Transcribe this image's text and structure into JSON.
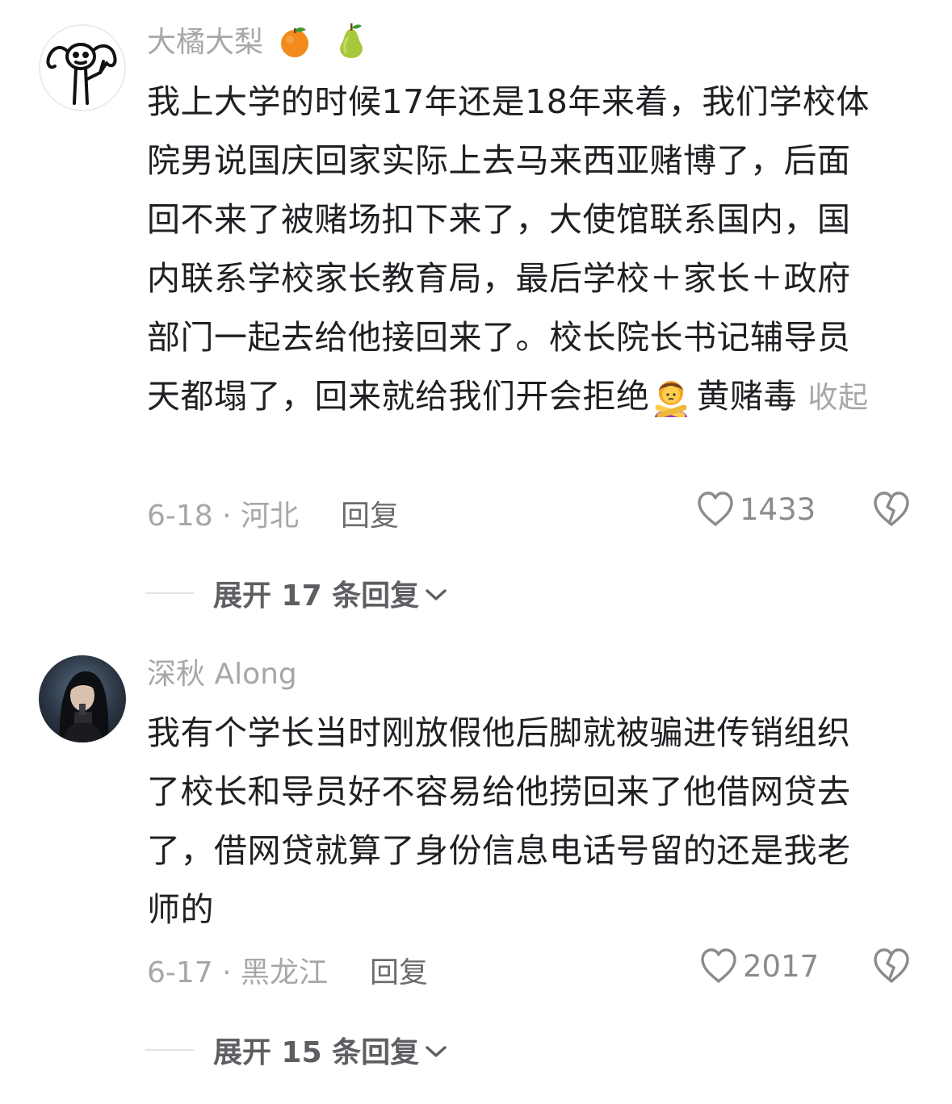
{
  "comments": [
    {
      "username": "大橘大梨",
      "username_emojis": [
        "orange-emoji",
        "pear-emoji"
      ],
      "content": "我上大学的时候17年还是18年来着，我们学校体院男说国庆回家实际上去马来西亚赌博了，后面回不来了被赌场扣下来了，大使馆联系国内，国内联系学校家长教育局，最后学校＋家长＋政府部门一起去给他接回来了。校长院长书记辅导员天都塌了，回来就给我们开会拒绝",
      "content_tail": "黄赌毒",
      "collapse_label": "收起",
      "date_location": "6-18 · 河北",
      "reply_label": "回复",
      "likes": "1433",
      "expand_label": "展开 17 条回复"
    },
    {
      "username": "深秋 Along",
      "content": "我有个学长当时刚放假他后脚就被骗进传销组织了校长和导员好不容易给他捞回来了他借网贷去了，借网贷就算了身份信息电话号留的还是我老师的",
      "date_location": "6-17 · 黑龙江",
      "reply_label": "回复",
      "likes": "2017",
      "expand_label": "展开 15 条回复"
    }
  ],
  "colors": {
    "text_primary": "#1f1f24",
    "text_secondary": "#a7a7ab",
    "reply_link": "#6b6b70",
    "expand_text": "#5e5e63"
  },
  "icons": [
    "heart-outline-icon",
    "broken-heart-icon",
    "chevron-down-icon"
  ]
}
